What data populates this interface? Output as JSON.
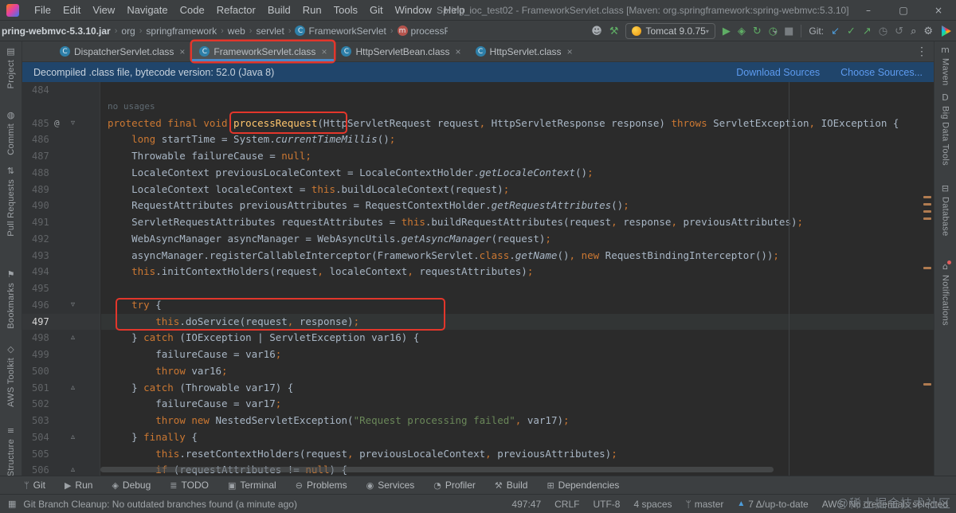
{
  "colors": {
    "accent_red": "#E3362B",
    "tab_underline": "#4A88C7",
    "banner_bg": "#20456B",
    "link_blue": "#5D9BF0",
    "keyword": "#CC7832",
    "default_text": "#A9B7C6",
    "method_decl": "#FFC66D",
    "string": "#6A8759",
    "line_number": "#606366",
    "run_green": "#5FAD65",
    "git_blue": "#4D9DDB",
    "editor_bg": "#2B2B2B",
    "chrome_bg": "#3C3F41"
  },
  "window": {
    "title": "Spring_ioc_test02 - FrameworkServlet.class [Maven: org.springframework:spring-webmvc:5.3.10]",
    "menus": [
      "File",
      "Edit",
      "View",
      "Navigate",
      "Code",
      "Refactor",
      "Build",
      "Run",
      "Tools",
      "Git",
      "Window",
      "Help"
    ],
    "controls": {
      "minimize": "–",
      "maximize": "▢",
      "close": "×"
    }
  },
  "toolbar": {
    "breadcrumbs": [
      {
        "label": "pring-webmvc-5.3.10.jar"
      },
      {
        "label": "org"
      },
      {
        "label": "springframework"
      },
      {
        "label": "web"
      },
      {
        "label": "servlet"
      },
      {
        "label": "FrameworkServlet",
        "icon": "class"
      },
      {
        "label": "processRequest",
        "icon": "method"
      }
    ],
    "run_config": "Tomcat 9.0.75",
    "git_label": "Git:"
  },
  "tabs": [
    {
      "label": "DispatcherServlet.class",
      "active": false
    },
    {
      "label": "FrameworkServlet.class",
      "active": true
    },
    {
      "label": "HttpServletBean.class",
      "active": false
    },
    {
      "label": "HttpServlet.class",
      "active": false
    }
  ],
  "banner": {
    "message": "Decompiled .class file, bytecode version: 52.0 (Java 8)",
    "download_label": "Download Sources",
    "choose_label": "Choose Sources..."
  },
  "left_stripe": [
    {
      "label": "Project",
      "icon": "project-icon",
      "glyph": "▤"
    },
    {
      "label": "Commit",
      "icon": "commit-icon",
      "glyph": "◍"
    },
    {
      "label": "Pull Requests",
      "icon": "pull-requests-icon",
      "glyph": "⇅"
    },
    {
      "label": "Bookmarks",
      "icon": "bookmarks-icon",
      "glyph": "⚑"
    },
    {
      "label": "AWS Toolkit",
      "icon": "aws-toolkit-icon",
      "glyph": "◇"
    },
    {
      "label": "Structure",
      "icon": "structure-icon",
      "glyph": "≡"
    }
  ],
  "right_stripe": [
    {
      "label": "Maven",
      "icon": "maven-icon",
      "glyph": "m"
    },
    {
      "label": "Big Data Tools",
      "icon": "big-data-tools-icon",
      "glyph": "D"
    },
    {
      "label": "Database",
      "icon": "database-icon",
      "glyph": "⊟"
    },
    {
      "label": "Notifications",
      "icon": "notifications-bell-icon",
      "glyph": "⌂",
      "badge": true
    }
  ],
  "editor": {
    "lines": [
      {
        "num": 484,
        "t": []
      },
      {
        "inlay": "no usages"
      },
      {
        "num": 485,
        "g": [
          "at",
          "open"
        ],
        "t": [
          [
            "k",
            "protected final void "
          ],
          [
            "m",
            "processRequest"
          ],
          [
            "d",
            "(HttpServletRequest request"
          ],
          [
            "k",
            ","
          ],
          [
            "d",
            " HttpServletResponse response) "
          ],
          [
            "k",
            "throws "
          ],
          [
            "d",
            "ServletException"
          ],
          [
            "k",
            ","
          ],
          [
            "d",
            " IOException {"
          ]
        ]
      },
      {
        "num": 486,
        "t": [
          [
            "d",
            "    "
          ],
          [
            "k",
            "long "
          ],
          [
            "d",
            "startTime = System."
          ],
          [
            "i",
            "currentTimeMillis"
          ],
          [
            "d",
            "()"
          ],
          [
            "k",
            ";"
          ]
        ]
      },
      {
        "num": 487,
        "t": [
          [
            "d",
            "    Throwable failureCause = "
          ],
          [
            "k",
            "null"
          ],
          [
            "k",
            ";"
          ]
        ]
      },
      {
        "num": 488,
        "t": [
          [
            "d",
            "    LocaleContext previousLocaleContext = LocaleContextHolder."
          ],
          [
            "i",
            "getLocaleContext"
          ],
          [
            "d",
            "()"
          ],
          [
            "k",
            ";"
          ]
        ]
      },
      {
        "num": 489,
        "t": [
          [
            "d",
            "    LocaleContext localeContext = "
          ],
          [
            "k",
            "this"
          ],
          [
            "d",
            ".buildLocaleContext(request)"
          ],
          [
            "k",
            ";"
          ]
        ]
      },
      {
        "num": 490,
        "t": [
          [
            "d",
            "    RequestAttributes previousAttributes = RequestContextHolder."
          ],
          [
            "i",
            "getRequestAttributes"
          ],
          [
            "d",
            "()"
          ],
          [
            "k",
            ";"
          ]
        ]
      },
      {
        "num": 491,
        "t": [
          [
            "d",
            "    ServletRequestAttributes requestAttributes = "
          ],
          [
            "k",
            "this"
          ],
          [
            "d",
            ".buildRequestAttributes(request"
          ],
          [
            "k",
            ","
          ],
          [
            "d",
            " response"
          ],
          [
            "k",
            ","
          ],
          [
            "d",
            " previousAttributes)"
          ],
          [
            "k",
            ";"
          ]
        ]
      },
      {
        "num": 492,
        "t": [
          [
            "d",
            "    WebAsyncManager asyncManager = WebAsyncUtils."
          ],
          [
            "i",
            "getAsyncManager"
          ],
          [
            "d",
            "(request)"
          ],
          [
            "k",
            ";"
          ]
        ]
      },
      {
        "num": 493,
        "t": [
          [
            "d",
            "    asyncManager.registerCallableInterceptor(FrameworkServlet."
          ],
          [
            "k",
            "class"
          ],
          [
            "d",
            "."
          ],
          [
            "i",
            "getName"
          ],
          [
            "d",
            "()"
          ],
          [
            "k",
            ", new "
          ],
          [
            "d",
            "RequestBindingInterceptor())"
          ],
          [
            "k",
            ";"
          ]
        ]
      },
      {
        "num": 494,
        "t": [
          [
            "d",
            "    "
          ],
          [
            "k",
            "this"
          ],
          [
            "d",
            ".initContextHolders(request"
          ],
          [
            "k",
            ","
          ],
          [
            "d",
            " localeContext"
          ],
          [
            "k",
            ","
          ],
          [
            "d",
            " requestAttributes)"
          ],
          [
            "k",
            ";"
          ]
        ]
      },
      {
        "num": 495,
        "t": []
      },
      {
        "num": 496,
        "g": [
          "open"
        ],
        "t": [
          [
            "d",
            "    "
          ],
          [
            "k",
            "try "
          ],
          [
            "d",
            "{"
          ]
        ]
      },
      {
        "num": 497,
        "cur": true,
        "t": [
          [
            "d",
            "        "
          ],
          [
            "k",
            "this"
          ],
          [
            "d",
            ".doService(request"
          ],
          [
            "k",
            ","
          ],
          [
            "d",
            " response)"
          ],
          [
            "k",
            ";"
          ]
        ]
      },
      {
        "num": 498,
        "g": [
          "close"
        ],
        "t": [
          [
            "d",
            "    } "
          ],
          [
            "k",
            "catch "
          ],
          [
            "d",
            "(IOException | ServletException var16) {"
          ]
        ]
      },
      {
        "num": 499,
        "t": [
          [
            "d",
            "        failureCause = var16"
          ],
          [
            "k",
            ";"
          ]
        ]
      },
      {
        "num": 500,
        "t": [
          [
            "d",
            "        "
          ],
          [
            "k",
            "throw "
          ],
          [
            "d",
            "var16"
          ],
          [
            "k",
            ";"
          ]
        ]
      },
      {
        "num": 501,
        "g": [
          "close"
        ],
        "t": [
          [
            "d",
            "    } "
          ],
          [
            "k",
            "catch "
          ],
          [
            "d",
            "(Throwable var17) {"
          ]
        ]
      },
      {
        "num": 502,
        "t": [
          [
            "d",
            "        failureCause = var17"
          ],
          [
            "k",
            ";"
          ]
        ]
      },
      {
        "num": 503,
        "t": [
          [
            "d",
            "        "
          ],
          [
            "k",
            "throw new "
          ],
          [
            "d",
            "NestedServletException("
          ],
          [
            "s",
            "\"Request processing failed\""
          ],
          [
            "k",
            ","
          ],
          [
            "d",
            " var17)"
          ],
          [
            "k",
            ";"
          ]
        ]
      },
      {
        "num": 504,
        "g": [
          "close"
        ],
        "t": [
          [
            "d",
            "    } "
          ],
          [
            "k",
            "finally "
          ],
          [
            "d",
            "{"
          ]
        ]
      },
      {
        "num": 505,
        "t": [
          [
            "d",
            "        "
          ],
          [
            "k",
            "this"
          ],
          [
            "d",
            ".resetContextHolders(request"
          ],
          [
            "k",
            ","
          ],
          [
            "d",
            " previousLocaleContext"
          ],
          [
            "k",
            ","
          ],
          [
            "d",
            " previousAttributes)"
          ],
          [
            "k",
            ";"
          ]
        ]
      },
      {
        "num": 506,
        "g": [
          "close"
        ],
        "t": [
          [
            "d",
            "        "
          ],
          [
            "k",
            "if "
          ],
          [
            "d",
            "(requestAttributes != "
          ],
          [
            "k",
            "null"
          ],
          [
            "d",
            ") {"
          ]
        ]
      }
    ]
  },
  "tool_window_bar": [
    {
      "label": "Git",
      "icon": "git-branch-icon",
      "glyph": "ᛘ"
    },
    {
      "label": "Run",
      "icon": "run-icon",
      "glyph": "▶"
    },
    {
      "label": "Debug",
      "icon": "debug-icon",
      "glyph": "◈"
    },
    {
      "label": "TODO",
      "icon": "todo-icon",
      "glyph": "≣"
    },
    {
      "label": "Terminal",
      "icon": "terminal-icon",
      "glyph": "▣"
    },
    {
      "label": "Problems",
      "icon": "problems-icon",
      "glyph": "⊖"
    },
    {
      "label": "Services",
      "icon": "services-icon",
      "glyph": "◉"
    },
    {
      "label": "Profiler",
      "icon": "profiler-icon",
      "glyph": "◔"
    },
    {
      "label": "Build",
      "icon": "build-icon",
      "glyph": "⚒"
    },
    {
      "label": "Dependencies",
      "icon": "dependencies-icon",
      "glyph": "⊞"
    }
  ],
  "status_bar": {
    "message": "Git Branch Cleanup: No outdated branches found (a minute ago)",
    "position": "497:47",
    "line_separator": "CRLF",
    "encoding": "UTF-8",
    "indent": "4 spaces",
    "branch": "master",
    "sync_status": "7 Δ/up-to-date",
    "aws_status": "AWS: No credentials selected",
    "watermark": "@稀土掘金技术社区"
  }
}
